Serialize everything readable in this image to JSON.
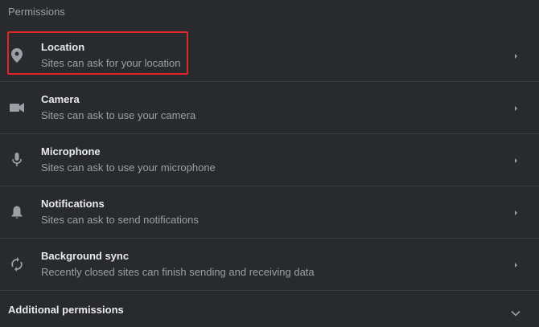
{
  "section": {
    "title": "Permissions"
  },
  "permissions": [
    {
      "label": "Location",
      "description": "Sites can ask for your location",
      "icon": "location-pin-icon"
    },
    {
      "label": "Camera",
      "description": "Sites can ask to use your camera",
      "icon": "camera-icon"
    },
    {
      "label": "Microphone",
      "description": "Sites can ask to use your microphone",
      "icon": "microphone-icon"
    },
    {
      "label": "Notifications",
      "description": "Sites can ask to send notifications",
      "icon": "bell-icon"
    },
    {
      "label": "Background sync",
      "description": "Recently closed sites can finish sending and receiving data",
      "icon": "sync-icon"
    }
  ],
  "additional": {
    "label": "Additional permissions"
  },
  "colors": {
    "background": "#292a2d",
    "highlight": "#e0262b",
    "text_primary": "#e8eaed",
    "text_secondary": "#9aa0a6"
  }
}
